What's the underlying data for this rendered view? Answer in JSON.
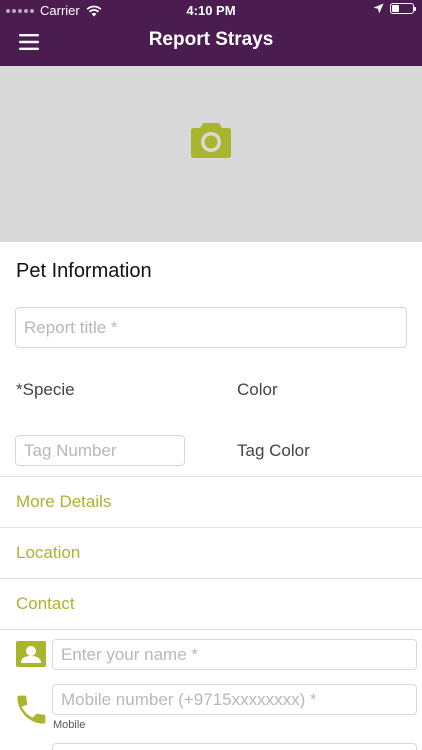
{
  "status_bar": {
    "carrier": "Carrier",
    "time": "4:10 PM"
  },
  "nav": {
    "title": "Report Strays"
  },
  "photo": {
    "icon": "camera-icon"
  },
  "pet_info": {
    "heading": "Pet Information",
    "report_title_placeholder": "Report title *",
    "specie_label": "*Specie",
    "color_label": "Color",
    "tag_number_placeholder": "Tag Number",
    "tag_color_label": "Tag Color"
  },
  "sections": {
    "more_details": "More Details",
    "location": "Location",
    "contact": "Contact"
  },
  "contact": {
    "name_placeholder": "Enter your name *",
    "mobile_placeholder": "Mobile number (+9715xxxxxxxx) *",
    "mobile_label": "Mobile"
  },
  "colors": {
    "brand": "#4a1c4f",
    "accent": "#a9b42f",
    "photo_bg": "#d9d9d9"
  }
}
